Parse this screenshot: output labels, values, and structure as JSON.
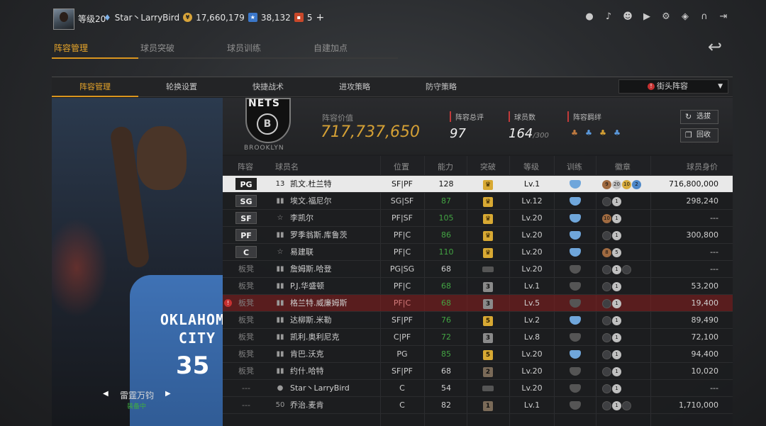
{
  "top": {
    "level": "等级20",
    "username": "Star丶LarryBird",
    "coins": "17,660,179",
    "points": "38,132",
    "tickets": "5",
    "plus": "+"
  },
  "main_tabs": [
    "阵容管理",
    "球员突破",
    "球员训练",
    "自建加点"
  ],
  "sub_tabs": [
    "阵容管理",
    "轮换设置",
    "快捷战术",
    "进攻策略",
    "防守策略"
  ],
  "lineup_select": "街头阵容",
  "portrait": {
    "team": "雷霆万钧",
    "status": "装备中",
    "jersey_text": "OKLAHOMA\nCITY",
    "jersey_number": "35"
  },
  "team": {
    "logo_text": "NETS",
    "logo_sub": "BROOKLYN",
    "value_label": "阵容价值",
    "value": "717,737,650",
    "rating_label": "阵容总评",
    "rating": "97",
    "count_label": "球员数",
    "count": "164",
    "count_max": "/300",
    "chem_label": "阵容羁绊",
    "btn_select": "选拔",
    "btn_recycle": "回收"
  },
  "columns": [
    "阵容",
    "球员名",
    "位置",
    "能力",
    "突破",
    "等级",
    "训练",
    "徽章",
    "球员身价"
  ],
  "rows": [
    {
      "slot": "PG",
      "bench": false,
      "icon": "13",
      "name": "凯文.杜兰特",
      "pos": "SF|PF",
      "ability": "128",
      "green": false,
      "breakthrough": "crown",
      "level": "Lv.1",
      "train": true,
      "badges": [
        {
          "c": "b",
          "t": "9"
        },
        {
          "c": "s",
          "t": "20"
        },
        {
          "c": "g",
          "t": "10"
        },
        {
          "c": "bl",
          "t": "2"
        }
      ],
      "value": "716,800,000",
      "selected": true,
      "warn": false
    },
    {
      "slot": "SG",
      "bench": false,
      "icon": "bars",
      "name": "埃文.福尼尔",
      "pos": "SG|SF",
      "ability": "87",
      "green": true,
      "breakthrough": "crown",
      "level": "Lv.12",
      "train": true,
      "badges": [
        {
          "c": "e",
          "t": ""
        },
        {
          "c": "s",
          "t": "1"
        }
      ],
      "value": "298,240",
      "selected": false,
      "warn": false
    },
    {
      "slot": "SF",
      "bench": false,
      "icon": "star",
      "name": "李凯尔",
      "pos": "PF|SF",
      "ability": "105",
      "green": true,
      "breakthrough": "crown",
      "level": "Lv.20",
      "train": true,
      "badges": [
        {
          "c": "b",
          "t": "10"
        },
        {
          "c": "s",
          "t": "1"
        }
      ],
      "value": "---",
      "selected": false,
      "warn": false
    },
    {
      "slot": "PF",
      "bench": false,
      "icon": "bars",
      "name": "罗季翁斯.库鲁茨",
      "pos": "PF|C",
      "ability": "86",
      "green": true,
      "breakthrough": "crown",
      "level": "Lv.20",
      "train": true,
      "badges": [
        {
          "c": "e",
          "t": ""
        },
        {
          "c": "s",
          "t": "1"
        }
      ],
      "value": "300,800",
      "selected": false,
      "warn": false
    },
    {
      "slot": "C",
      "bench": false,
      "icon": "star",
      "name": "易建联",
      "pos": "PF|C",
      "ability": "110",
      "green": true,
      "breakthrough": "crown",
      "level": "Lv.20",
      "train": true,
      "badges": [
        {
          "c": "b",
          "t": "8"
        },
        {
          "c": "s",
          "t": "5"
        }
      ],
      "value": "---",
      "selected": false,
      "warn": false
    },
    {
      "slot": "板凳",
      "bench": true,
      "icon": "bars",
      "name": "詹姆斯.哈登",
      "pos": "PG|SG",
      "ability": "68",
      "green": false,
      "breakthrough": "empty",
      "level": "Lv.20",
      "train": false,
      "badges": [
        {
          "c": "e",
          "t": ""
        },
        {
          "c": "s",
          "t": "1"
        },
        {
          "c": "e",
          "t": ""
        }
      ],
      "value": "---",
      "selected": false,
      "warn": false
    },
    {
      "slot": "板凳",
      "bench": true,
      "icon": "bars",
      "name": "P.J.华盛顿",
      "pos": "PF|C",
      "ability": "68",
      "green": true,
      "breakthrough": "3",
      "level": "Lv.1",
      "train": false,
      "badges": [
        {
          "c": "e",
          "t": ""
        },
        {
          "c": "s",
          "t": "1"
        }
      ],
      "value": "53,200",
      "selected": false,
      "warn": false
    },
    {
      "slot": "板凳",
      "bench": true,
      "icon": "bars",
      "name": "格兰特.威廉姆斯",
      "pos": "PF|C",
      "ability": "68",
      "green": true,
      "breakthrough": "3",
      "level": "Lv.5",
      "train": false,
      "badges": [
        {
          "c": "e",
          "t": ""
        },
        {
          "c": "s",
          "t": "1"
        }
      ],
      "value": "19,400",
      "selected": false,
      "warn": true
    },
    {
      "slot": "板凳",
      "bench": true,
      "icon": "bars",
      "name": "达柳斯.米勒",
      "pos": "SF|PF",
      "ability": "76",
      "green": true,
      "breakthrough": "5",
      "level": "Lv.2",
      "train": true,
      "badges": [
        {
          "c": "e",
          "t": ""
        },
        {
          "c": "s",
          "t": "1"
        }
      ],
      "value": "89,490",
      "selected": false,
      "warn": false
    },
    {
      "slot": "板凳",
      "bench": true,
      "icon": "bars",
      "name": "凯利.奥利尼克",
      "pos": "C|PF",
      "ability": "72",
      "green": true,
      "breakthrough": "3",
      "level": "Lv.8",
      "train": false,
      "badges": [
        {
          "c": "e",
          "t": ""
        },
        {
          "c": "s",
          "t": "1"
        }
      ],
      "value": "72,100",
      "selected": false,
      "warn": false
    },
    {
      "slot": "板凳",
      "bench": true,
      "icon": "bars",
      "name": "肯巴.沃克",
      "pos": "PG",
      "ability": "85",
      "green": true,
      "breakthrough": "5",
      "level": "Lv.20",
      "train": true,
      "badges": [
        {
          "c": "e",
          "t": ""
        },
        {
          "c": "s",
          "t": "1"
        }
      ],
      "value": "94,400",
      "selected": false,
      "warn": false
    },
    {
      "slot": "板凳",
      "bench": true,
      "icon": "bars",
      "name": "约什.哈特",
      "pos": "SF|PF",
      "ability": "68",
      "green": false,
      "breakthrough": "2",
      "level": "Lv.20",
      "train": false,
      "badges": [
        {
          "c": "e",
          "t": ""
        },
        {
          "c": "s",
          "t": "1"
        }
      ],
      "value": "10,020",
      "selected": false,
      "warn": false
    },
    {
      "slot": "---",
      "bench": true,
      "icon": "person",
      "name": "Star丶LarryBird",
      "pos": "C",
      "ability": "54",
      "green": false,
      "breakthrough": "empty",
      "level": "Lv.20",
      "train": false,
      "badges": [
        {
          "c": "e",
          "t": ""
        },
        {
          "c": "s",
          "t": "1"
        }
      ],
      "value": "---",
      "selected": false,
      "warn": false
    },
    {
      "slot": "---",
      "bench": true,
      "icon": "50",
      "name": "乔治.麦肯",
      "pos": "C",
      "ability": "82",
      "green": false,
      "breakthrough": "1",
      "level": "Lv.1",
      "train": false,
      "badges": [
        {
          "c": "e",
          "t": ""
        },
        {
          "c": "s",
          "t": "1"
        },
        {
          "c": "e",
          "t": ""
        }
      ],
      "value": "1,710,000",
      "selected": false,
      "warn": false
    }
  ]
}
